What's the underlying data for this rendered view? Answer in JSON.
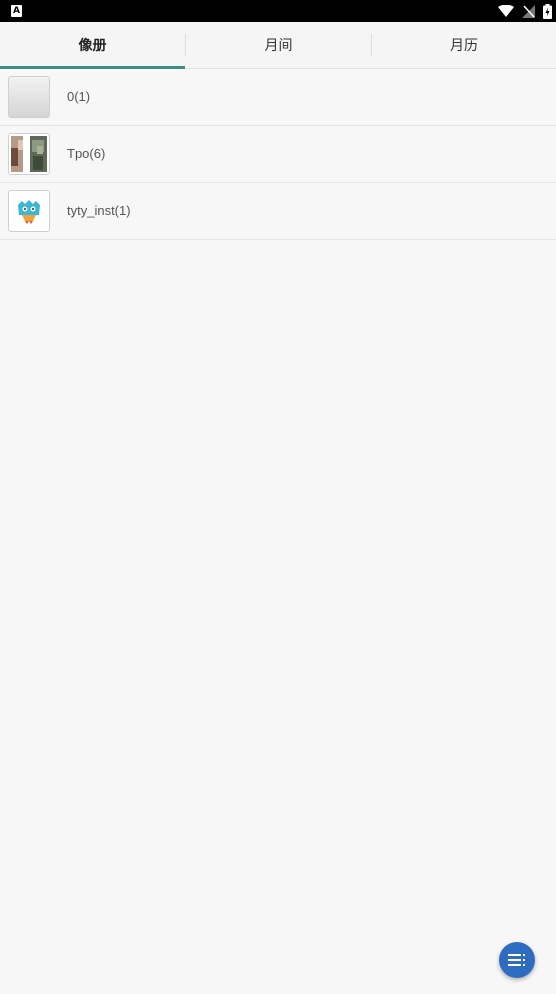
{
  "status_bar": {
    "left_icon_letter": "A",
    "icons": [
      "wifi-icon",
      "no-signal-icon",
      "battery-charging-icon"
    ]
  },
  "tabs": [
    {
      "label": "像册",
      "active": true
    },
    {
      "label": "月间",
      "active": false
    },
    {
      "label": "月历",
      "active": false
    }
  ],
  "accent_color": "#3f8e86",
  "albums": [
    {
      "label": "0(1)",
      "thumb": "blank-thumbnail"
    },
    {
      "label": "Tpo(6)",
      "thumb": "photo-thumbnail"
    },
    {
      "label": "tyty_inst(1)",
      "thumb": "monster-icon-thumbnail"
    }
  ],
  "fab": {
    "icon": "menu-list-icon",
    "color": "#2d6cc0"
  }
}
